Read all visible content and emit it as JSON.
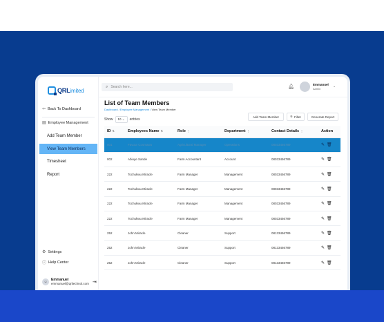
{
  "brand": {
    "logo_main": "QRL",
    "logo_sub": "imited"
  },
  "sidebar": {
    "back_label": "Back To Dashboard",
    "section_label": "Employee Management",
    "nav": [
      {
        "label": "Add Team Member",
        "active": false
      },
      {
        "label": "View Team Members",
        "active": true
      },
      {
        "label": "Timesheet",
        "active": false
      },
      {
        "label": "Report",
        "active": false
      }
    ],
    "settings_label": "Settings",
    "help_label": "Help Center",
    "user": {
      "name": "Emmanuel",
      "email": "emmanuel@qrltechnol.com"
    }
  },
  "topbar": {
    "search_placeholder": "Search here...",
    "user_name": "Emmanuel",
    "user_role": "Admin"
  },
  "page": {
    "title": "List of Team Members",
    "breadcrumb": [
      "Dashboard",
      "Employee Management",
      "View Team Member"
    ],
    "show_label": "Show",
    "show_value": "10",
    "entries_label": "entries",
    "buttons": {
      "add": "Add Team Member",
      "filter": "Filter",
      "generate": "Generate Report"
    }
  },
  "table": {
    "headers": [
      "ID",
      "Employees Name",
      "Role",
      "Department",
      "Contact Details",
      "Action"
    ],
    "rows": [
      {
        "id": "001",
        "name": "Favour Cosmawo",
        "role": "Agricultural Manager",
        "dept": "Operations",
        "contact": "08033456789",
        "selected": true
      },
      {
        "id": "002",
        "name": "Abioye Sande",
        "role": "Farm Accountant",
        "dept": "Account",
        "contact": "08033456789",
        "selected": false
      },
      {
        "id": "222",
        "name": "Tochukwu Miracle",
        "role": "Farm Manager",
        "dept": "Management",
        "contact": "08033456789",
        "selected": false
      },
      {
        "id": "222",
        "name": "Tochukwu Miracle",
        "role": "Farm Manager",
        "dept": "Management",
        "contact": "08033456789",
        "selected": false
      },
      {
        "id": "222",
        "name": "Tochukwu Miracle",
        "role": "Farm Manager",
        "dept": "Management",
        "contact": "08033456789",
        "selected": false
      },
      {
        "id": "222",
        "name": "Tochukwu Miracle",
        "role": "Farm Manager",
        "dept": "Management",
        "contact": "08033456789",
        "selected": false
      },
      {
        "id": "252",
        "name": "John Miracle",
        "role": "Cleaner",
        "dept": "Support",
        "contact": "08133456789",
        "selected": false
      },
      {
        "id": "252",
        "name": "John Miracle",
        "role": "Cleaner",
        "dept": "Support",
        "contact": "08133456789",
        "selected": false
      },
      {
        "id": "252",
        "name": "John Miracle",
        "role": "Cleaner",
        "dept": "Support",
        "contact": "08133456789",
        "selected": false
      }
    ]
  },
  "colors": {
    "brand_blue": "#083c8f",
    "accent": "#1f8fe0",
    "active_nav": "#64b5f6",
    "selected_row": "#1686c9"
  }
}
